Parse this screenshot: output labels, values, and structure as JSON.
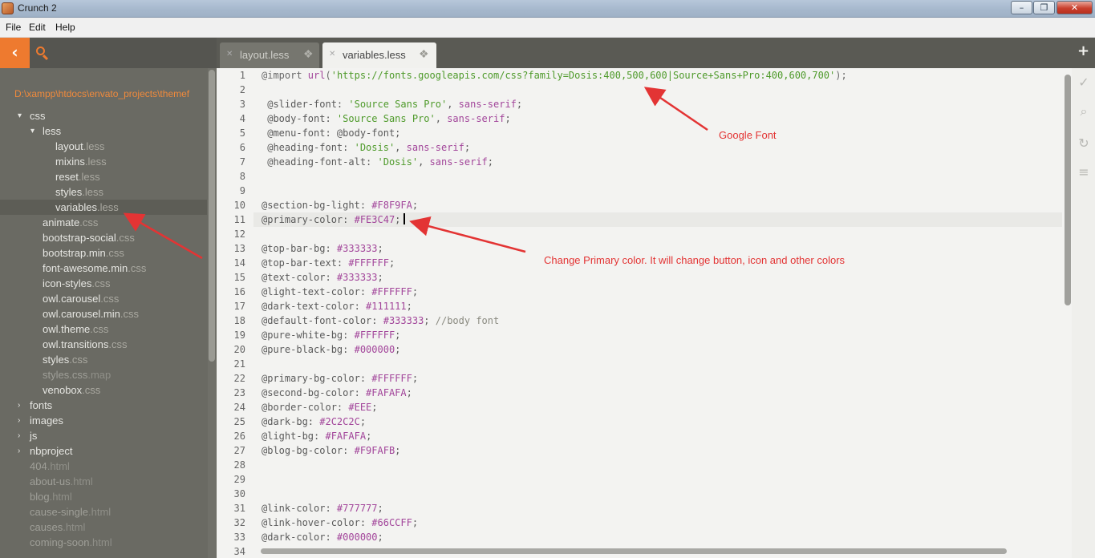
{
  "window": {
    "title": "Crunch 2",
    "min": "–",
    "max": "❐",
    "close": "✕"
  },
  "menu": [
    "File",
    "Edit",
    "Help"
  ],
  "sidebar": {
    "back_icon": "‹",
    "path": "D:\\xampp\\htdocs\\envato_projects\\themef",
    "tree": [
      {
        "name": "css",
        "ext": "",
        "level": 1,
        "arrow": "▾"
      },
      {
        "name": "less",
        "ext": "",
        "level": 2,
        "arrow": "▾"
      },
      {
        "name": "layout",
        "ext": ".less",
        "level": 3
      },
      {
        "name": "mixins",
        "ext": ".less",
        "level": 3
      },
      {
        "name": "reset",
        "ext": ".less",
        "level": 3
      },
      {
        "name": "styles",
        "ext": ".less",
        "level": 3
      },
      {
        "name": "variables",
        "ext": ".less",
        "level": 3,
        "selected": true
      },
      {
        "name": "animate",
        "ext": ".css",
        "level": 2
      },
      {
        "name": "bootstrap-social",
        "ext": ".css",
        "level": 2
      },
      {
        "name": "bootstrap.min",
        "ext": ".css",
        "level": 2
      },
      {
        "name": "font-awesome.min",
        "ext": ".css",
        "level": 2
      },
      {
        "name": "icon-styles",
        "ext": ".css",
        "level": 2
      },
      {
        "name": "owl.carousel",
        "ext": ".css",
        "level": 2
      },
      {
        "name": "owl.carousel.min",
        "ext": ".css",
        "level": 2
      },
      {
        "name": "owl.theme",
        "ext": ".css",
        "level": 2
      },
      {
        "name": "owl.transitions",
        "ext": ".css",
        "level": 2
      },
      {
        "name": "styles",
        "ext": ".css",
        "level": 2
      },
      {
        "name": "styles.css",
        "ext": ".map",
        "level": 2,
        "dim": true
      },
      {
        "name": "venobox",
        "ext": ".css",
        "level": 2
      },
      {
        "name": "fonts",
        "ext": "",
        "level": 1,
        "arrow": "›"
      },
      {
        "name": "images",
        "ext": "",
        "level": 1,
        "arrow": "›"
      },
      {
        "name": "js",
        "ext": "",
        "level": 1,
        "arrow": "›"
      },
      {
        "name": "nbproject",
        "ext": "",
        "level": 1,
        "arrow": "›"
      },
      {
        "name": "404",
        "ext": ".html",
        "level": 1,
        "dim": true
      },
      {
        "name": "about-us",
        "ext": ".html",
        "level": 1,
        "dim": true
      },
      {
        "name": "blog",
        "ext": ".html",
        "level": 1,
        "dim": true
      },
      {
        "name": "cause-single",
        "ext": ".html",
        "level": 1,
        "dim": true
      },
      {
        "name": "causes",
        "ext": ".html",
        "level": 1,
        "dim": true
      },
      {
        "name": "coming-soon",
        "ext": ".html",
        "level": 1,
        "dim": true
      }
    ]
  },
  "tabs": [
    {
      "label": "layout.less",
      "active": false
    },
    {
      "label": "variables.less",
      "active": true
    }
  ],
  "tab_close_icon": "✕",
  "tab_chevron_icon": "❖",
  "add_tab_icon": "+",
  "editor": {
    "active_line": 11,
    "lines": [
      [
        [
          "kw",
          "@import "
        ],
        [
          "val",
          "url"
        ],
        [
          "kw",
          "("
        ],
        [
          "str",
          "'https://fonts.googleapis.com/css?family=Dosis:400,500,600|Source+Sans+Pro:400,600,700'"
        ],
        [
          "kw",
          ");"
        ]
      ],
      [],
      [
        [
          "prop",
          " @slider-font: "
        ],
        [
          "str",
          "'Source Sans Pro'"
        ],
        [
          "prop",
          ", "
        ],
        [
          "val",
          "sans-serif"
        ],
        [
          "prop",
          ";"
        ]
      ],
      [
        [
          "prop",
          " @body-font: "
        ],
        [
          "str",
          "'Source Sans Pro'"
        ],
        [
          "prop",
          ", "
        ],
        [
          "val",
          "sans-serif"
        ],
        [
          "prop",
          ";"
        ]
      ],
      [
        [
          "prop",
          " @menu-font: @body-font;"
        ]
      ],
      [
        [
          "prop",
          " @heading-font: "
        ],
        [
          "str",
          "'Dosis'"
        ],
        [
          "prop",
          ", "
        ],
        [
          "val",
          "sans-serif"
        ],
        [
          "prop",
          ";"
        ]
      ],
      [
        [
          "prop",
          " @heading-font-alt: "
        ],
        [
          "str",
          "'Dosis'"
        ],
        [
          "prop",
          ", "
        ],
        [
          "val",
          "sans-serif"
        ],
        [
          "prop",
          ";"
        ]
      ],
      [],
      [],
      [
        [
          "prop",
          "@section-bg-light: "
        ],
        [
          "val",
          "#F8F9FA"
        ],
        [
          "prop",
          ";"
        ]
      ],
      [
        [
          "prop",
          "@primary-color: "
        ],
        [
          "val",
          "#FE3C47"
        ],
        [
          "prop",
          ";"
        ]
      ],
      [],
      [
        [
          "prop",
          "@top-bar-bg: "
        ],
        [
          "val",
          "#333333"
        ],
        [
          "prop",
          ";"
        ]
      ],
      [
        [
          "prop",
          "@top-bar-text: "
        ],
        [
          "val",
          "#FFFFFF"
        ],
        [
          "prop",
          ";"
        ]
      ],
      [
        [
          "prop",
          "@text-color: "
        ],
        [
          "val",
          "#333333"
        ],
        [
          "prop",
          ";"
        ]
      ],
      [
        [
          "prop",
          "@light-text-color: "
        ],
        [
          "val",
          "#FFFFFF"
        ],
        [
          "prop",
          ";"
        ]
      ],
      [
        [
          "prop",
          "@dark-text-color: "
        ],
        [
          "val",
          "#111111"
        ],
        [
          "prop",
          ";"
        ]
      ],
      [
        [
          "prop",
          "@default-font-color: "
        ],
        [
          "val",
          "#333333"
        ],
        [
          "prop",
          "; "
        ],
        [
          "cm",
          "//body font"
        ]
      ],
      [
        [
          "prop",
          "@pure-white-bg: "
        ],
        [
          "val",
          "#FFFFFF"
        ],
        [
          "prop",
          ";"
        ]
      ],
      [
        [
          "prop",
          "@pure-black-bg: "
        ],
        [
          "val",
          "#000000"
        ],
        [
          "prop",
          ";"
        ]
      ],
      [],
      [
        [
          "prop",
          "@primary-bg-color: "
        ],
        [
          "val",
          "#FFFFFF"
        ],
        [
          "prop",
          ";"
        ]
      ],
      [
        [
          "prop",
          "@second-bg-color: "
        ],
        [
          "val",
          "#FAFAFA"
        ],
        [
          "prop",
          ";"
        ]
      ],
      [
        [
          "prop",
          "@border-color: "
        ],
        [
          "val",
          "#EEE"
        ],
        [
          "prop",
          ";"
        ]
      ],
      [
        [
          "prop",
          "@dark-bg: "
        ],
        [
          "val",
          "#2C2C2C"
        ],
        [
          "prop",
          ";"
        ]
      ],
      [
        [
          "prop",
          "@light-bg: "
        ],
        [
          "val",
          "#FAFAFA"
        ],
        [
          "prop",
          ";"
        ]
      ],
      [
        [
          "prop",
          "@blog-bg-color: "
        ],
        [
          "val",
          "#F9FAFB"
        ],
        [
          "prop",
          ";"
        ]
      ],
      [],
      [],
      [],
      [
        [
          "prop",
          "@link-color: "
        ],
        [
          "val",
          "#777777"
        ],
        [
          "prop",
          ";"
        ]
      ],
      [
        [
          "prop",
          "@link-hover-color: "
        ],
        [
          "val",
          "#66CCFF"
        ],
        [
          "prop",
          ";"
        ]
      ],
      [
        [
          "prop",
          "@dark-color: "
        ],
        [
          "val",
          "#000000"
        ],
        [
          "prop",
          ";"
        ]
      ],
      []
    ]
  },
  "annotations": {
    "google_font": "Google Font",
    "primary_color": "Change Primary color. It will change button, icon and other colors"
  },
  "colors": {
    "accent": "#ee7a2f",
    "annotation": "#e33434"
  }
}
